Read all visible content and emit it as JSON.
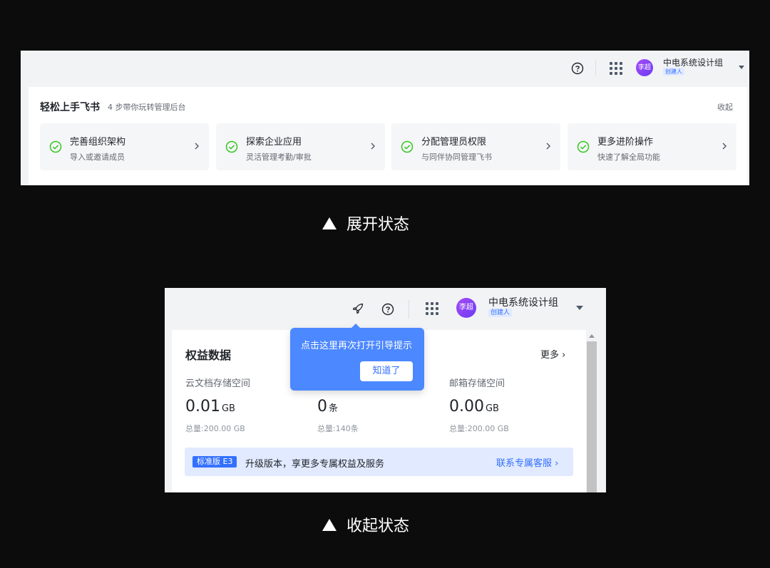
{
  "expanded": {
    "org": {
      "avatar_text": "李超",
      "name": "中电系统设计组",
      "role": "创建人"
    },
    "guide": {
      "title": "轻松上手飞书",
      "subtitle": "4 步带你玩转管理后台",
      "collapse_label": "收起",
      "steps": [
        {
          "title": "完善组织架构",
          "desc": "导入或邀请成员"
        },
        {
          "title": "探索企业应用",
          "desc": "灵活管理考勤/审批"
        },
        {
          "title": "分配管理员权限",
          "desc": "与同伴协同管理飞书"
        },
        {
          "title": "更多进阶操作",
          "desc": "快速了解全局功能"
        }
      ]
    },
    "caption": "展开状态"
  },
  "collapsed": {
    "org": {
      "avatar_text": "李超",
      "name": "中电系统设计组",
      "role": "创建人"
    },
    "popover": {
      "text": "点击这里再次打开引导提示",
      "button_label": "知道了"
    },
    "section": {
      "title": "权益数据",
      "more_label": "更多 ›",
      "stats": [
        {
          "label": "云文档存储空间",
          "value": "0.01",
          "unit": "GB",
          "total": "总量:200.00 GB"
        },
        {
          "label": "",
          "value": "0",
          "unit": "条",
          "total": "总量:140条"
        },
        {
          "label": "邮箱存储空间",
          "value": "0.00",
          "unit": "GB",
          "total": "总量:200.00 GB"
        }
      ],
      "upgrade": {
        "badge": "标准版 E3",
        "text": "升级版本，享更多专属权益及服务",
        "link": "联系专属客服 ›"
      }
    },
    "caption": "收起状态"
  },
  "colors": {
    "accent": "#3370ff",
    "popover": "#4c88ff",
    "check": "#34c724",
    "page_bg": "#0c0c0c"
  }
}
